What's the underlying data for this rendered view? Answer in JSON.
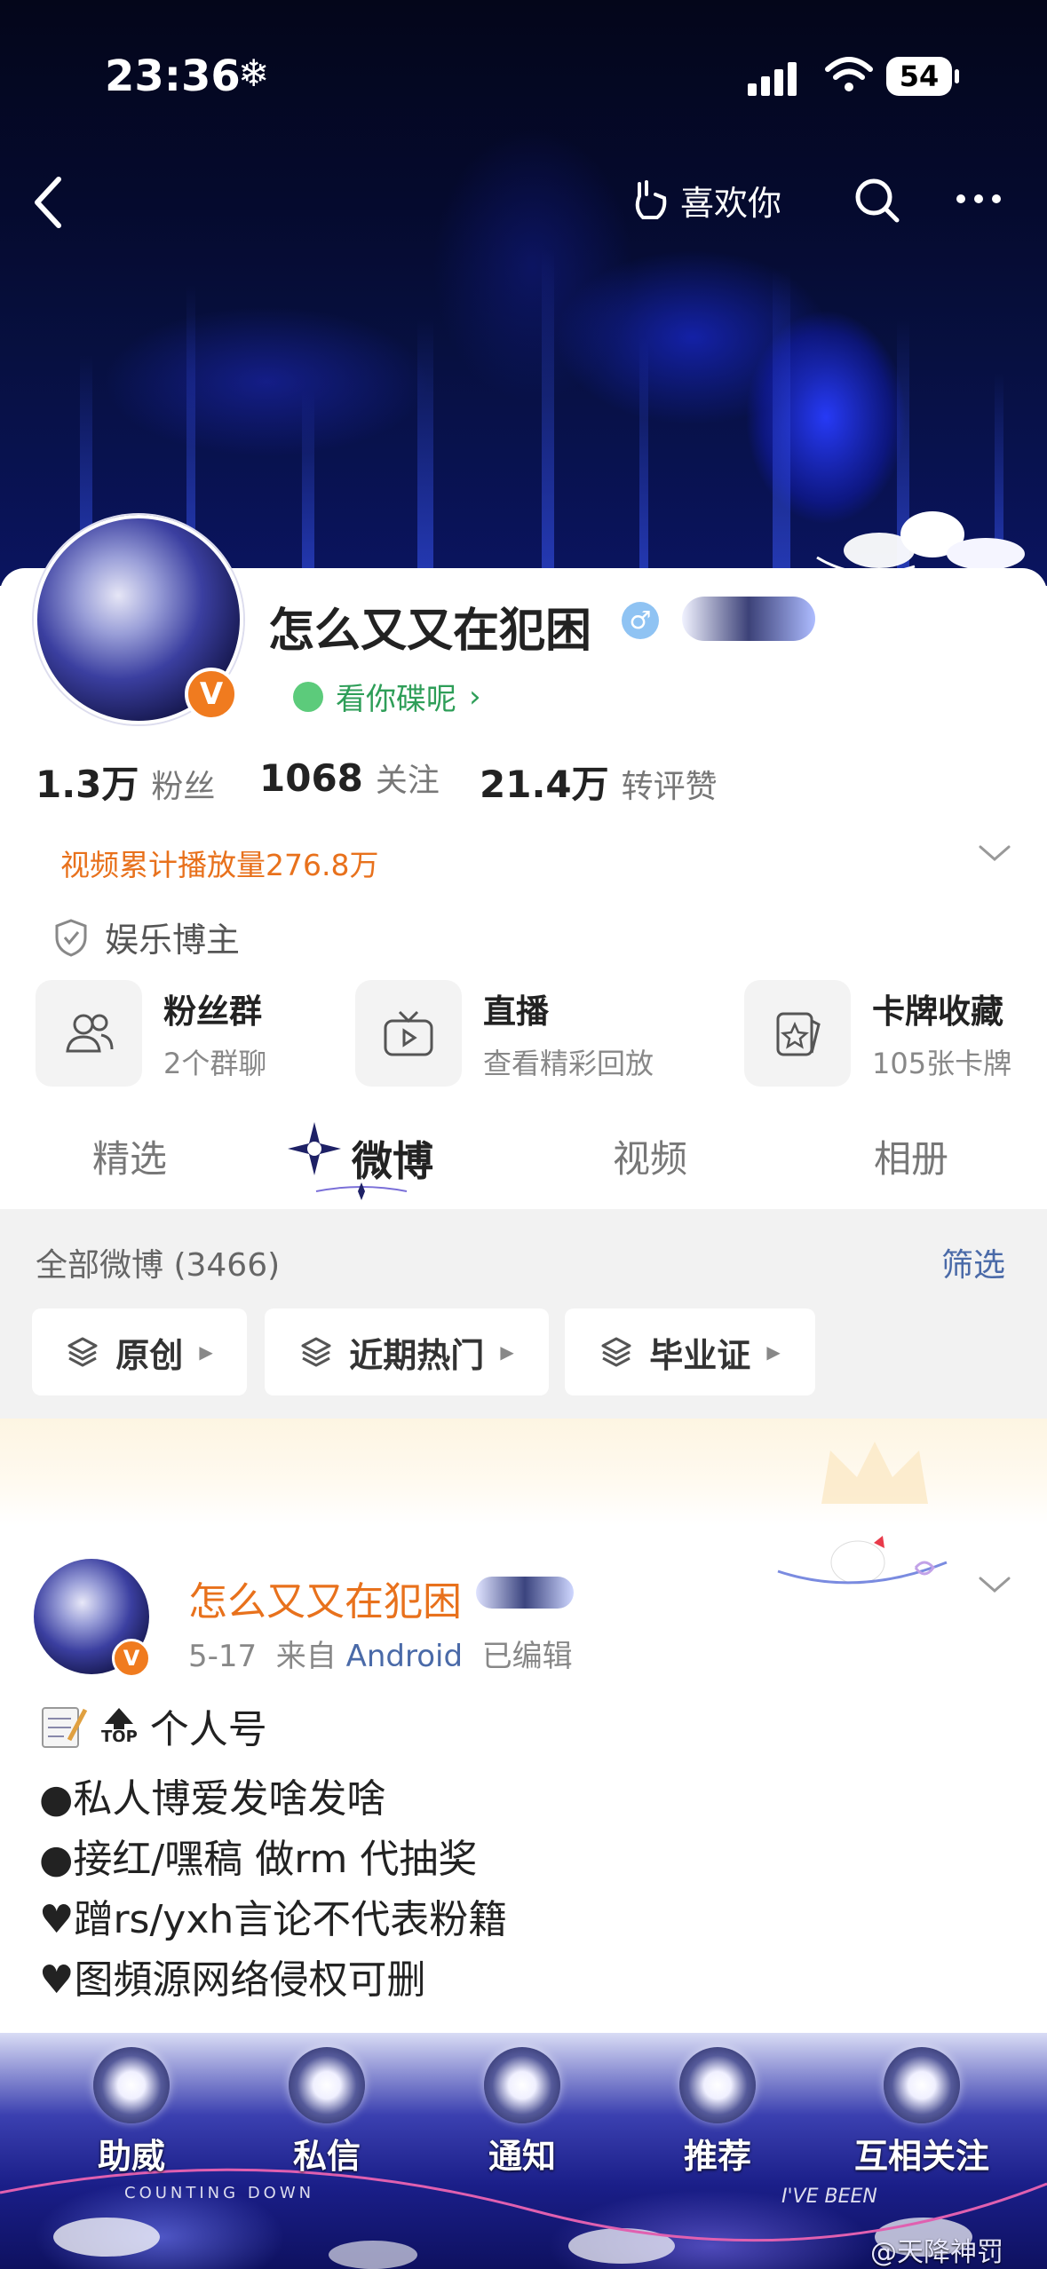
{
  "status_bar": {
    "time": "23:36",
    "weather_glyph": "❄",
    "battery": "54"
  },
  "header": {
    "like_label": "喜欢你"
  },
  "profile": {
    "username": "怎么又又在犯困",
    "gender_symbol": "♂",
    "verified_badge": "V",
    "mood_label": "看你碟呢",
    "mood_arrow": "›",
    "stats": [
      {
        "value": "1.3万",
        "label": "粉丝"
      },
      {
        "value": "1068",
        "label": "关注"
      },
      {
        "value": "21.4万",
        "label": "转评赞"
      }
    ],
    "video_plays": "视频累计播放量276.8万",
    "tag": "娱乐博主"
  },
  "features": [
    {
      "title": "粉丝群",
      "sub": "2个群聊",
      "icon": "fans-group-icon"
    },
    {
      "title": "直播",
      "sub": "查看精彩回放",
      "icon": "tv-icon"
    },
    {
      "title": "卡牌收藏",
      "sub": "105张卡牌",
      "icon": "card-icon"
    }
  ],
  "tabs": [
    "精选",
    "微博",
    "视频",
    "相册"
  ],
  "feed": {
    "all_label": "全部微博 (3466)",
    "filter_label": "筛选",
    "chips": [
      "原创",
      "近期热门",
      "毕业证"
    ]
  },
  "post": {
    "author": "怎么又又在犯困",
    "date": "5-17",
    "from_label": "来自",
    "source": "Android",
    "edited": "已编辑",
    "top_label": "TOP",
    "lines": [
      "个人号",
      "●私人博爱发啥发啥",
      "●接红/嘿稿 做rm 代抽奖",
      "♥蹭rs/yxh言论不代表粉籍",
      "♥图頻源网络侵权可删"
    ]
  },
  "bottom_nav": [
    "助威",
    "私信",
    "通知",
    "推荐",
    "互相关注"
  ],
  "decor_text": {
    "left": "COUNTING DOWN",
    "right": "I'VE BEEN"
  },
  "watermark": "@天降神罚",
  "colors": {
    "accent_orange": "#e8711c",
    "link_blue": "#4a6aa8",
    "verified_green": "#2e9e58"
  }
}
